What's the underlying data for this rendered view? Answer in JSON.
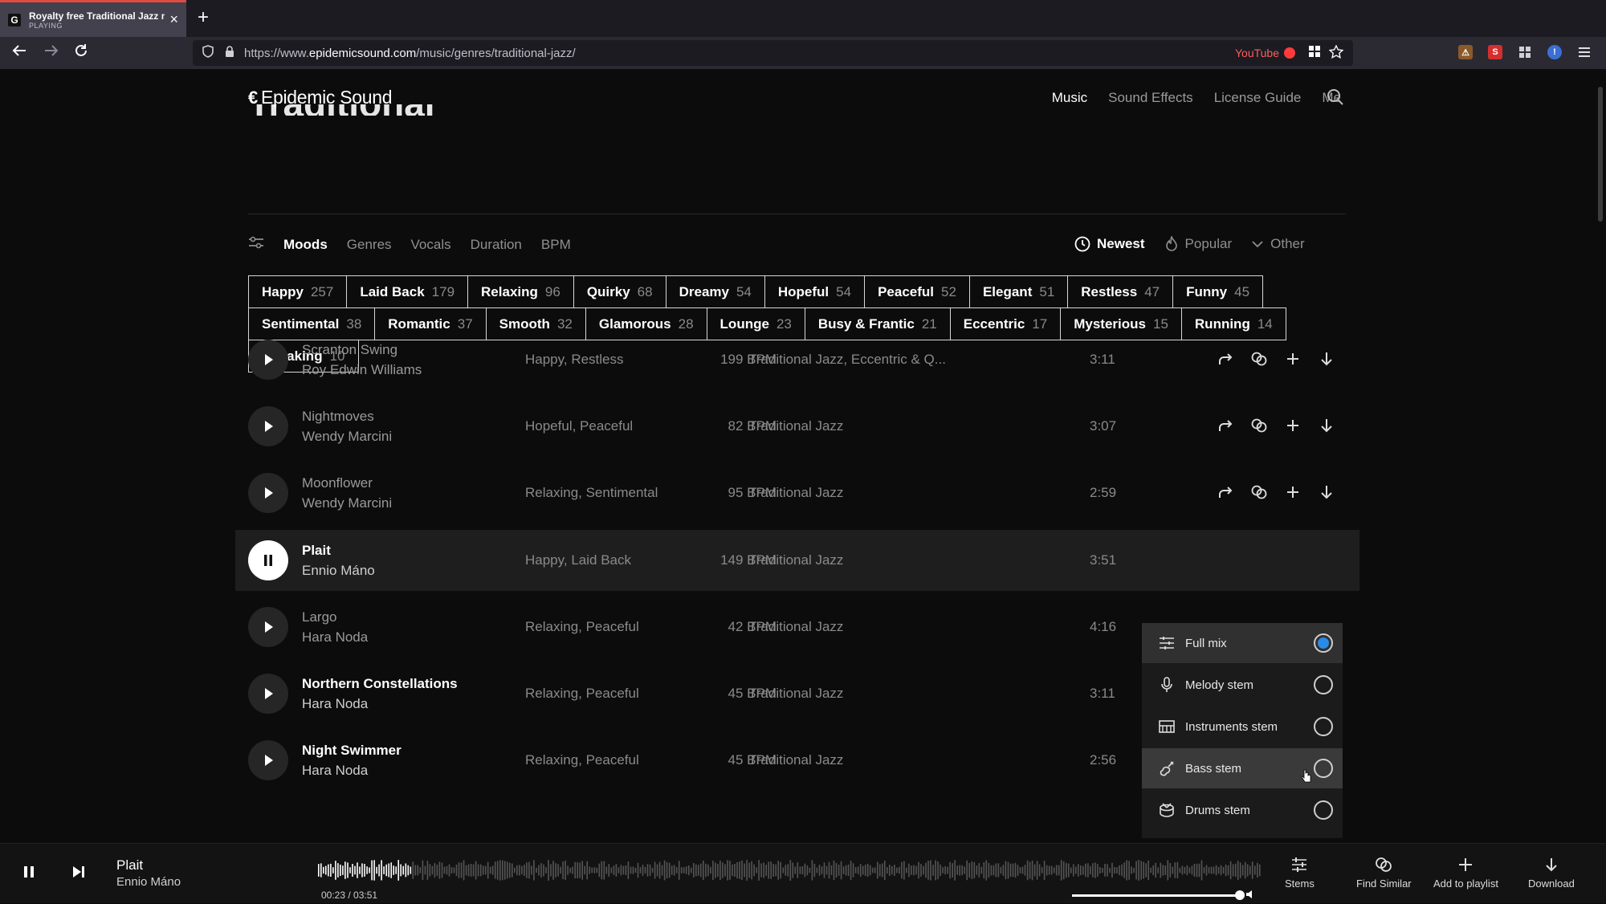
{
  "browser": {
    "tab_title": "Royalty free Traditional Jazz mu",
    "tab_status": "PLAYING",
    "tab_favicon": "G",
    "url_prefix": "https://www.",
    "url_host": "epidemicsound.com",
    "url_path": "/music/genres/traditional-jazz/",
    "youtube_label": "YouTube"
  },
  "site": {
    "logo_text": "Epidemic Sound",
    "logo_mark": "€",
    "ghost_title": "Traditional Jazz",
    "nav": [
      "Music",
      "Sound Effects",
      "License Guide",
      "Me"
    ]
  },
  "filters": {
    "tabs": [
      "Moods",
      "Genres",
      "Vocals",
      "Duration",
      "BPM"
    ],
    "sort": [
      "Newest",
      "Popular",
      "Other"
    ]
  },
  "moods": [
    [
      {
        "name": "Happy",
        "count": "257"
      },
      {
        "name": "Laid Back",
        "count": "179"
      },
      {
        "name": "Relaxing",
        "count": "96"
      },
      {
        "name": "Quirky",
        "count": "68"
      },
      {
        "name": "Dreamy",
        "count": "54"
      },
      {
        "name": "Hopeful",
        "count": "54"
      },
      {
        "name": "Peaceful",
        "count": "52"
      },
      {
        "name": "Elegant",
        "count": "51"
      },
      {
        "name": "Restless",
        "count": "47"
      },
      {
        "name": "Funny",
        "count": "45"
      }
    ],
    [
      {
        "name": "Sentimental",
        "count": "38"
      },
      {
        "name": "Romantic",
        "count": "37"
      },
      {
        "name": "Smooth",
        "count": "32"
      },
      {
        "name": "Glamorous",
        "count": "28"
      },
      {
        "name": "Lounge",
        "count": "23"
      },
      {
        "name": "Busy & Frantic",
        "count": "21"
      },
      {
        "name": "Eccentric",
        "count": "17"
      },
      {
        "name": "Mysterious",
        "count": "15"
      },
      {
        "name": "Running",
        "count": "14"
      }
    ],
    [
      {
        "name": "Sneaking",
        "count": "10"
      }
    ]
  ],
  "tracks": [
    {
      "title": "Scranton Swing",
      "artist": "Roy Edwin Williams",
      "moods": "Happy, Restless",
      "genre": "Traditional Jazz, Eccentric & Q...",
      "bpm": "199 BPM",
      "duration": "3:11"
    },
    {
      "title": "Nightmoves",
      "artist": "Wendy Marcini",
      "moods": "Hopeful, Peaceful",
      "genre": "Traditional Jazz",
      "bpm": "82 BPM",
      "duration": "3:07"
    },
    {
      "title": "Moonflower",
      "artist": "Wendy Marcini",
      "moods": "Relaxing, Sentimental",
      "genre": "Traditional Jazz",
      "bpm": "95 BPM",
      "duration": "2:59"
    },
    {
      "title": "Plait",
      "artist": "Ennio Máno",
      "moods": "Happy, Laid Back",
      "genre": "Traditional Jazz",
      "bpm": "149 BPM",
      "duration": "3:51"
    },
    {
      "title": "Largo",
      "artist": "Hara Noda",
      "moods": "Relaxing, Peaceful",
      "genre": "Traditional Jazz",
      "bpm": "42 BPM",
      "duration": "4:16"
    },
    {
      "title": "Northern Constellations",
      "artist": "Hara Noda",
      "moods": "Relaxing, Peaceful",
      "genre": "Traditional Jazz",
      "bpm": "45 BPM",
      "duration": "3:11"
    },
    {
      "title": "Night Swimmer",
      "artist": "Hara Noda",
      "moods": "Relaxing, Peaceful",
      "genre": "Traditional Jazz",
      "bpm": "45 BPM",
      "duration": "2:56"
    }
  ],
  "stems_menu": {
    "items": [
      "Full mix",
      "Melody stem",
      "Instruments stem",
      "Bass stem",
      "Drums stem"
    ],
    "selected": "Full mix"
  },
  "player": {
    "title": "Plait",
    "artist": "Ennio Máno",
    "time": "00:23 / 03:51",
    "progress_fraction": 0.1,
    "volume_fraction": 0.97,
    "tools": [
      "Stems",
      "Find Similar",
      "Add to playlist",
      "Download"
    ]
  },
  "colors": {
    "accent_radio": "#2a8ae8",
    "recording_red": "#e04a3f"
  }
}
